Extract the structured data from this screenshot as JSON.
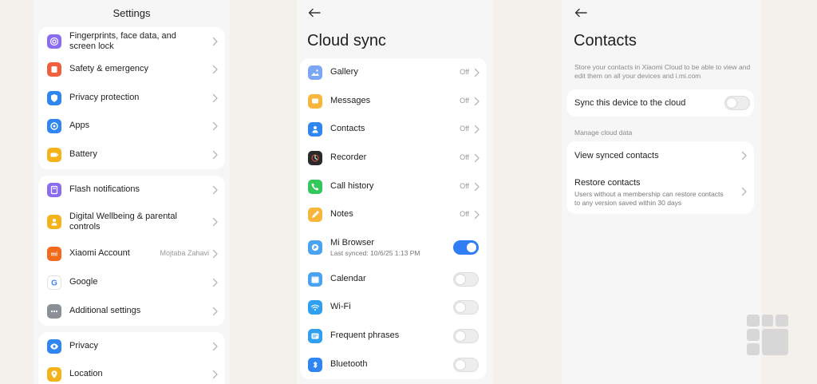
{
  "settings": {
    "title": "Settings",
    "group1": [
      {
        "label": "Fingerprints, face data, and screen lock",
        "icon": "fingerprint-icon",
        "color": "#8b6cf0"
      },
      {
        "label": "Safety & emergency",
        "icon": "sos-icon",
        "color": "#f0603c"
      },
      {
        "label": "Privacy protection",
        "icon": "shield-icon",
        "color": "#2f86f0"
      },
      {
        "label": "Apps",
        "icon": "apps-icon",
        "color": "#2f86f0"
      },
      {
        "label": "Battery",
        "icon": "battery-icon",
        "color": "#f4b21b"
      }
    ],
    "group2": [
      {
        "label": "Flash notifications",
        "icon": "flash-icon",
        "color": "#8b6cf0"
      },
      {
        "label": "Digital Wellbeing & parental controls",
        "icon": "wellbeing-icon",
        "color": "#f4b21b"
      },
      {
        "label": "Xiaomi Account",
        "value": "Mojtaba Zahavi",
        "icon": "mi-icon",
        "color": "#f26a1b"
      },
      {
        "label": "Google",
        "icon": "google-icon",
        "color": "#ffffff"
      },
      {
        "label": "Additional settings",
        "icon": "more-icon",
        "color": "#8a8f98"
      }
    ],
    "group3": [
      {
        "label": "Privacy",
        "icon": "eye-icon",
        "color": "#2f86f0"
      },
      {
        "label": "Location",
        "icon": "location-icon",
        "color": "#f4b21b"
      }
    ]
  },
  "cloud_sync": {
    "title": "Cloud sync",
    "items": [
      {
        "label": "Gallery",
        "value": "Off",
        "icon": "gallery-icon",
        "color": "#7aa6f5",
        "type": "link"
      },
      {
        "label": "Messages",
        "value": "Off",
        "icon": "messages-icon",
        "color": "#f6b73c",
        "type": "link"
      },
      {
        "label": "Contacts",
        "value": "Off",
        "icon": "contacts-icon",
        "color": "#2f86f0",
        "type": "link"
      },
      {
        "label": "Recorder",
        "value": "Off",
        "icon": "recorder-icon",
        "color": "#2a2a2a",
        "type": "link"
      },
      {
        "label": "Call history",
        "value": "Off",
        "icon": "phone-icon",
        "color": "#34c759",
        "type": "link"
      },
      {
        "label": "Notes",
        "value": "Off",
        "icon": "notes-icon",
        "color": "#f6b73c",
        "type": "link"
      },
      {
        "label": "Mi Browser",
        "sub": "Last synced: 10/6/25 1:13 PM",
        "icon": "browser-icon",
        "color": "#4aa3f0",
        "type": "toggle",
        "on": true
      },
      {
        "label": "Calendar",
        "icon": "calendar-icon",
        "color": "#4aa3f0",
        "type": "toggle",
        "on": false
      },
      {
        "label": "Wi-Fi",
        "icon": "wifi-icon",
        "color": "#2fa0f0",
        "type": "toggle",
        "on": false
      },
      {
        "label": "Frequent phrases",
        "icon": "phrases-icon",
        "color": "#2fa0f0",
        "type": "toggle",
        "on": false
      },
      {
        "label": "Bluetooth",
        "icon": "bluetooth-icon",
        "color": "#2f86f0",
        "type": "toggle",
        "on": false
      }
    ]
  },
  "contacts": {
    "title": "Contacts",
    "description": "Store your contacts in Xiaomi Cloud to be able to view and edit them on all your devices and i.mi.com",
    "sync_label": "Sync this device to the cloud",
    "sync_on": false,
    "manage_header": "Manage cloud data",
    "view_synced": "View synced contacts",
    "restore_title": "Restore contacts",
    "restore_sub": "Users without a membership can restore contacts to any version saved within 30 days"
  },
  "colors": {
    "accent": "#2f7ef5",
    "background": "#f6f6f7",
    "card": "#ffffff"
  }
}
